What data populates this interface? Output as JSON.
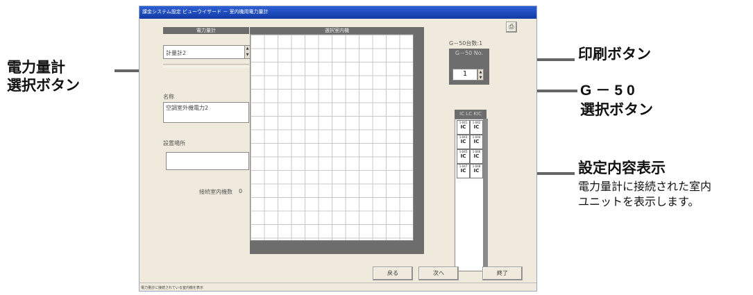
{
  "window": {
    "title": "課金システム設定 ビューウイザード － 室内機用電力量計",
    "status_text": "電力量計に接続されている室内機を表示"
  },
  "left_panel": {
    "header": "電力量計",
    "meter_value": "計量計2",
    "name_label": "名称",
    "name_value": "空調室外機電力2",
    "location_label": "設置場所",
    "location_value": "",
    "connected_label": "接続室内機数",
    "connected_count": "0"
  },
  "grid_panel": {
    "header": "選択室内機"
  },
  "right_panel": {
    "g50_count": "G－50台数:1",
    "g50_no_label": "G－50 No.",
    "g50_no_value": "1",
    "column_header": "IC LC KIC",
    "cells": [
      {
        "id": "1-041",
        "type": "IC"
      },
      {
        "id": "1-042",
        "type": "IC"
      },
      {
        "id": "1-043",
        "type": "IC"
      },
      {
        "id": "1-044",
        "type": "IC"
      },
      {
        "id": "1-045",
        "type": "IC"
      },
      {
        "id": "1-046",
        "type": "IC"
      },
      {
        "id": "1-047",
        "type": "IC"
      },
      {
        "id": "1-048",
        "type": "IC"
      }
    ]
  },
  "buttons": {
    "back": "戻る",
    "next": "次へ",
    "finish": "終了"
  },
  "icons": {
    "print": "printer-icon",
    "spin_up": "arrow-up-icon",
    "spin_down": "arrow-down-icon"
  },
  "callouts": {
    "meter_select_line1": "電力量計",
    "meter_select_line2": "選択ボタン",
    "print_button": "印刷ボタン",
    "g50_select_line1": "G－50",
    "g50_select_line2": "選択ボタン",
    "settings_display": "設定内容表示",
    "settings_desc_line1": "電力量計に接続された室内",
    "settings_desc_line2": "ユニットを表示します。"
  }
}
